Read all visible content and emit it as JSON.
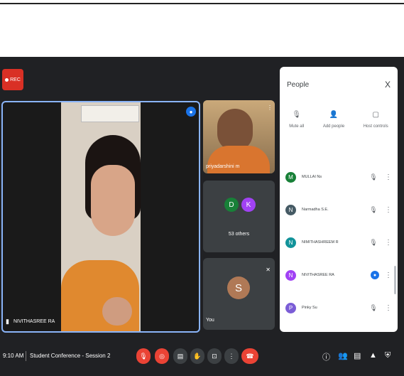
{
  "rec": {
    "label": "REC"
  },
  "main_tile": {
    "name": "NIVITHASREE RA"
  },
  "tiles": [
    {
      "name": "priyadarshini m"
    },
    {
      "avatars": [
        "D",
        "K"
      ],
      "label": "53 others"
    },
    {
      "avatar": "S",
      "label": "You"
    }
  ],
  "people_panel": {
    "title": "People",
    "close": "X",
    "actions": [
      {
        "label": "Mute all",
        "icon": "mic-off-icon"
      },
      {
        "label": "Add people",
        "icon": "add-person-icon"
      },
      {
        "label": "Host controls",
        "icon": "host-controls-icon"
      }
    ],
    "participants": [
      {
        "initial": "M",
        "name": "MULLAI Ns",
        "color": "#188038"
      },
      {
        "initial": "N",
        "name": "Narmadha S.E.",
        "color": "#455a64"
      },
      {
        "initial": "N",
        "name": "NIMITHASHREEM R",
        "color": "#12939a"
      },
      {
        "initial": "N",
        "name": "NIVITHASREE RA",
        "color": "#a142f4"
      },
      {
        "initial": "P",
        "name": "Pinky Su",
        "color": "#7b5dd6"
      }
    ]
  },
  "bottom_bar": {
    "time": "9:10 AM",
    "meeting_title": "Student Conference - Session 2"
  },
  "colors": {
    "background": "#202124",
    "accent": "#1a73e8",
    "danger": "#ea4335"
  }
}
